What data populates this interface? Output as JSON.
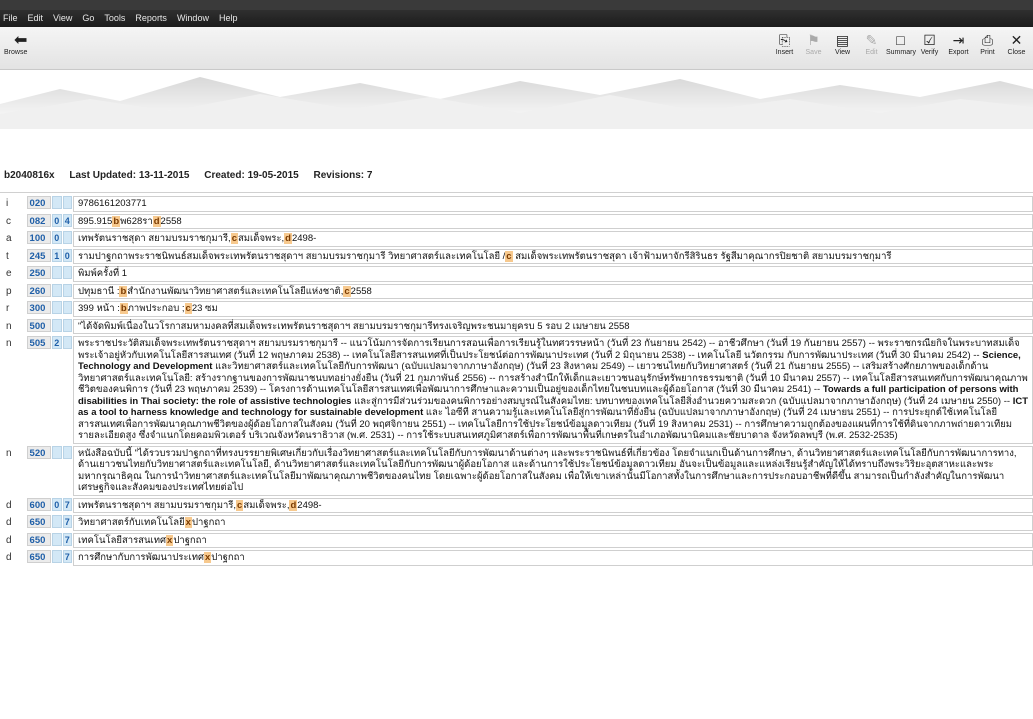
{
  "menu": [
    "File",
    "Edit",
    "View",
    "Go",
    "Tools",
    "Reports",
    "Window",
    "Help"
  ],
  "toolbar": {
    "left": {
      "label": "Browse",
      "icon": "back-arrow-icon"
    },
    "buttons": [
      {
        "label": "Insert",
        "icon": "insert-icon",
        "enabled": true
      },
      {
        "label": "Save",
        "icon": "save-icon",
        "enabled": false
      },
      {
        "label": "View",
        "icon": "view-icon",
        "enabled": true
      },
      {
        "label": "Edit",
        "icon": "edit-icon",
        "enabled": false
      },
      {
        "label": "Summary",
        "icon": "summary-icon",
        "enabled": true
      },
      {
        "label": "Verify",
        "icon": "verify-icon",
        "enabled": true
      },
      {
        "label": "Export",
        "icon": "export-icon",
        "enabled": true
      },
      {
        "label": "Print",
        "icon": "print-icon",
        "enabled": true
      },
      {
        "label": "Close",
        "icon": "close-icon",
        "enabled": true
      }
    ]
  },
  "record": {
    "id": "b2040816x",
    "last_updated": "Last Updated: 13-11-2015",
    "created": "Created: 19-05-2015",
    "revisions": "Revisions: 7"
  },
  "fields": [
    {
      "lead": "i",
      "tag": "020",
      "ind1": "",
      "ind2": "",
      "segments": [
        {
          "t": "9786161203771"
        }
      ]
    },
    {
      "lead": "c",
      "tag": "082",
      "ind1": "0",
      "ind2": "4",
      "segments": [
        {
          "t": "895.915"
        },
        {
          "sf": "b"
        },
        {
          "t": "พ628รา"
        },
        {
          "sf": "d"
        },
        {
          "t": "2558"
        }
      ]
    },
    {
      "lead": "a",
      "tag": "100",
      "ind1": "0",
      "ind2": "",
      "segments": [
        {
          "t": "เทพรัตนราชสุดา สยามบรมราชกุมารี,"
        },
        {
          "sf": "c"
        },
        {
          "t": "สมเด็จพระ,"
        },
        {
          "sf": "d"
        },
        {
          "t": "2498-"
        }
      ]
    },
    {
      "lead": "t",
      "tag": "245",
      "ind1": "1",
      "ind2": "0",
      "segments": [
        {
          "t": "รามปาฐกถาพระราชนิพนธ์สมเด็จพระเทพรัตนราชสุดาฯ สยามบรมราชกุมารี วิทยาศาสตร์และเทคโนโลยี /"
        },
        {
          "sf": "c"
        },
        {
          "t": " สมเด็จพระเทพรัตนราชสุดา เจ้าฟ้ามหาจักรีสิรินธร รัฐสีมาคุณากรปิยชาติ สยามบรมราชกุมารี"
        }
      ]
    },
    {
      "lead": "e",
      "tag": "250",
      "ind1": "",
      "ind2": "",
      "segments": [
        {
          "t": "พิมพ์ครั้งที่ 1"
        }
      ]
    },
    {
      "lead": "p",
      "tag": "260",
      "ind1": "",
      "ind2": "",
      "segments": [
        {
          "t": "ปทุมธานี :"
        },
        {
          "sf": "b"
        },
        {
          "t": "สำนักงานพัฒนาวิทยาศาสตร์และเทคโนโลยีแห่งชาติ,"
        },
        {
          "sf": "c"
        },
        {
          "t": "2558"
        }
      ]
    },
    {
      "lead": "r",
      "tag": "300",
      "ind1": "",
      "ind2": "",
      "segments": [
        {
          "t": "399 หน้า :"
        },
        {
          "sf": "b"
        },
        {
          "t": "ภาพประกอบ ;"
        },
        {
          "sf": "c"
        },
        {
          "t": "23 ซม"
        }
      ]
    },
    {
      "lead": "n",
      "tag": "500",
      "ind1": "",
      "ind2": "",
      "segments": [
        {
          "t": "\"ได้จัดพิมพ์เนื่องในวโรกาสมหามงคลที่สมเด็จพระเทพรัตนราชสุดาฯ สยามบรมราชกุมารีทรงเจริญพระชนมายุครบ 5 รอบ 2 เมษายน 2558"
        }
      ]
    },
    {
      "lead": "n",
      "tag": "505",
      "ind1": "2",
      "ind2": "",
      "segments": [
        {
          "t": "พระราชประวัติสมเด็จพระเทพรัตนราชสุดาฯ สยามบรมราชกุมารี -- แนวโน้มการจัดการเรียนการสอนเพื่อการเรียนรู้ในทศวรรษหน้า (วันที่ 23 กันยายน 2542) -- อาชีวศึกษา (วันที่ 19 กันยายน 2557) -- พระราชกรณียกิจในพระบาทสมเด็จพระเจ้าอยู่หัวกับเทคโนโลยีสารสนเทศ (วันที่ 12 พฤษภาคม 2538) -- เทคโนโลยีสารสนเทศที่เป็นประโยชน์ต่อการพัฒนาประเทศ (วันที่ 2 มิถุนายน 2538) -- เทคโนโลยี นวัตกรรม กับการพัฒนาประเทศ (วันที่ 30 มีนาคม 2542) -- "
        },
        {
          "t": "Science, Technology and Development",
          "b": true
        },
        {
          "t": " และวิทยาศาสตร์และเทคโนโลยีกับการพัฒนา (ฉบับแปลมาจากภาษาอังกฤษ) (วันที่ 23 สิงหาคม 2549) -- เยาวชนไทยกับวิทยาศาสตร์ (วันที่ 21 กันยายน 2555) -- เสริมสร้างศักยภาพของเด็กด้านวิทยาศาสตร์และเทคโนโลยี: สร้างรากฐานของการพัฒนาชนบทอย่างยั่งยืน (วันที่ 21 กุมภาพันธ์ 2556) -- การสร้างสำนึกให้เด็กและเยาวชนอนุรักษ์ทรัพยากรธรรมชาติ (วันที่ 10 มีนาคม 2557) -- เทคโนโลยีสารสนเทศกับการพัฒนาคุณภาพชีวิตของคนพิการ (วันที่ 23 พฤษภาคม 2539) -- โครงการด้านเทคโนโลยีสารสนเทศเพื่อพัฒนาการศึกษาและความเป็นอยู่ของเด็กไทยในชนบทและผู้ด้อยโอกาส (วันที่ 30 มีนาคม 2541) -- "
        },
        {
          "t": "Towards a full participation of persons with disabilities in Thai society: the role of assistive technologies",
          "b": true
        },
        {
          "t": " และสู่การมีส่วนร่วมของคนพิการอย่างสมบูรณ์ในสังคมไทย: บทบาทของเทคโนโลยีสิ่งอำนวยความสะดวก (ฉบับแปลมาจากภาษาอังกฤษ) (วันที่ 24 เมษายน 2550) -- "
        },
        {
          "t": "ICT as a tool to harness knowledge and technology for sustainable development",
          "b": true
        },
        {
          "t": " และ ไอซีที สานความรู้และเทคโนโลยีสู่การพัฒนาที่ยั่งยืน (ฉบับแปลมาจากภาษาอังกฤษ) (วันที่ 24 เมษายน 2551) -- การประยุกต์ใช้เทคโนโลยีสารสนเทศเพื่อการพัฒนาคุณภาพชีวิตของผู้ด้อยโอกาสในสังคม (วันที่ 20 พฤศจิกายน 2551) -- เทคโนโลยีการใช้ประโยชน์ข้อมูลดาวเทียม (วันที่ 19 สิงหาคม 2531) -- การศึกษาความถูกต้องของแผนที่การใช้ที่ดินจากภาพถ่ายดาวเทียมรายละเอียดสูง ซึ่งจำแนกโดยคอมพิวเตอร์ บริเวณจังหวัดนราธิวาส (พ.ศ. 2531) -- การใช้ระบบสนเทศภูมิศาสตร์เพื่อการพัฒนาพื้นที่เกษตรในอำเภอพัฒนานิคมและชัยบาดาล จังหวัดลพบุรี (พ.ศ. 2532-2535)"
        }
      ]
    },
    {
      "lead": "n",
      "tag": "520",
      "ind1": "",
      "ind2": "",
      "segments": [
        {
          "t": "หนังสือฉบับนี้ \"ได้รวบรวมปาฐกถาที่ทรงบรรยายพิเศษเกี่ยวกับเรื่องวิทยาศาสตร์และเทคโนโลยีกับการพัฒนาด้านต่างๆ และพระราชนิพนธ์ที่เกี่ยวข้อง โดยจำแนกเป็นด้านการศึกษา, ด้านวิทยาศาสตร์และเทคโนโลยีกับการพัฒนาการทาง, ด้านเยาวชนไทยกับวิทยาศาสตร์และเทคโนโลยี, ด้านวิทยาศาสตร์และเทคโนโลยีกับการพัฒนาผู้ด้อยโอกาส และด้านการใช้ประโยชน์ข้อมูลดาวเทียม อันจะเป็นข้อมูลและแหล่งเรียนรู้สำคัญให้ได้ทราบถึงพระวิริยะอุตสาหะและพระมหากรุณาธิคุณ ในการนำวิทยาศาสตร์และเทคโนโลยีมาพัฒนาคุณภาพชีวิตของคนไทย โดยเฉพาะผู้ด้อยโอกาสในสังคม เพื่อให้เขาเหล่านั้นมีโอกาสทั้งในการศึกษาและการประกอบอาชีพที่ดีขึ้น สามารถเป็นกำลังสำคัญในการพัฒนาเศรษฐกิจและสังคมของประเทศไทยต่อไป"
        }
      ]
    },
    {
      "lead": "d",
      "tag": "600",
      "ind1": "0",
      "ind2": "7",
      "segments": [
        {
          "t": "เทพรัตนราชสุดาฯ สยามบรมราชกุมารี,"
        },
        {
          "sf": "c"
        },
        {
          "t": "สมเด็จพระ,"
        },
        {
          "sf": "d"
        },
        {
          "t": "2498-"
        }
      ]
    },
    {
      "lead": "d",
      "tag": "650",
      "ind1": "",
      "ind2": "7",
      "segments": [
        {
          "t": "วิทยาศาสตร์กับเทคโนโลยี"
        },
        {
          "sf": "x"
        },
        {
          "t": "ปาฐกถา"
        }
      ]
    },
    {
      "lead": "d",
      "tag": "650",
      "ind1": "",
      "ind2": "7",
      "segments": [
        {
          "t": "เทคโนโลยีสารสนเทศ"
        },
        {
          "sf": "x"
        },
        {
          "t": "ปาฐกถา"
        }
      ]
    },
    {
      "lead": "d",
      "tag": "650",
      "ind1": "",
      "ind2": "7",
      "segments": [
        {
          "t": "การศึกษากับการพัฒนาประเทศ"
        },
        {
          "sf": "x"
        },
        {
          "t": "ปาฐกถา"
        }
      ]
    }
  ]
}
